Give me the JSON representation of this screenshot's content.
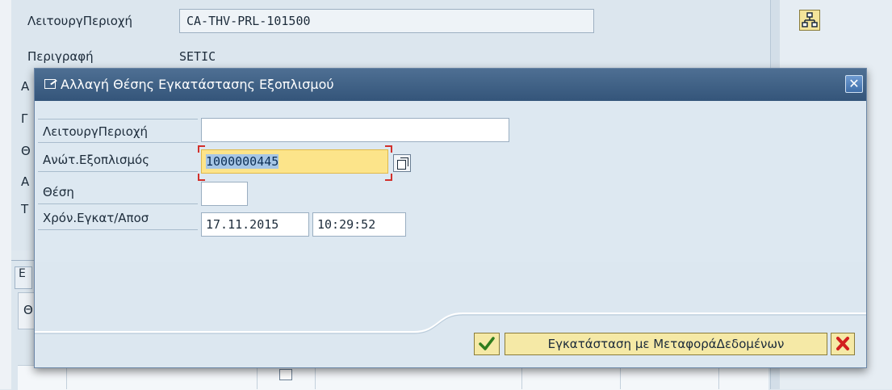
{
  "background": {
    "functional_location_label": "ΛειτουργΠεριοχή",
    "functional_location_value": "CA-THV-PRL-101500",
    "description_label": "Περιγραφή",
    "description_value": "SETIC",
    "hierarchy_icon": "hierarchy-icon",
    "partial_labels": [
      "Α",
      "Γ",
      "Θ",
      "Α",
      "Τ"
    ],
    "tab_partial_label": "Ε",
    "grid_partial_label": "Θ"
  },
  "dialog": {
    "title": "Αλλαγή Θέσης Εγκατάστασης Εξοπλισμού",
    "title_icon": "edit-window-icon",
    "close_icon": "close-icon",
    "fields": {
      "functional_location": {
        "label": "ΛειτουργΠεριοχή",
        "value": ""
      },
      "superior_equipment": {
        "label": "Ανώτ.Εξοπλισμός",
        "value": "1000000445"
      },
      "position": {
        "label": "Θέση",
        "value": ""
      },
      "install_datetime": {
        "label": "Χρόν.Εγκατ/Αποσ",
        "date": "17.11.2015",
        "time": "10:29:52"
      }
    },
    "buttons": {
      "confirm_icon": "checkmark-icon",
      "install_label": "Εγκατάσταση με ΜεταφοράΔεδομένων",
      "cancel_icon": "cancel-x-icon"
    },
    "colors": {
      "titlebar": "#3d5f85",
      "focused_field": "#fce48a",
      "button": "#f5e9a6",
      "required_marker": "#d2302b"
    }
  }
}
